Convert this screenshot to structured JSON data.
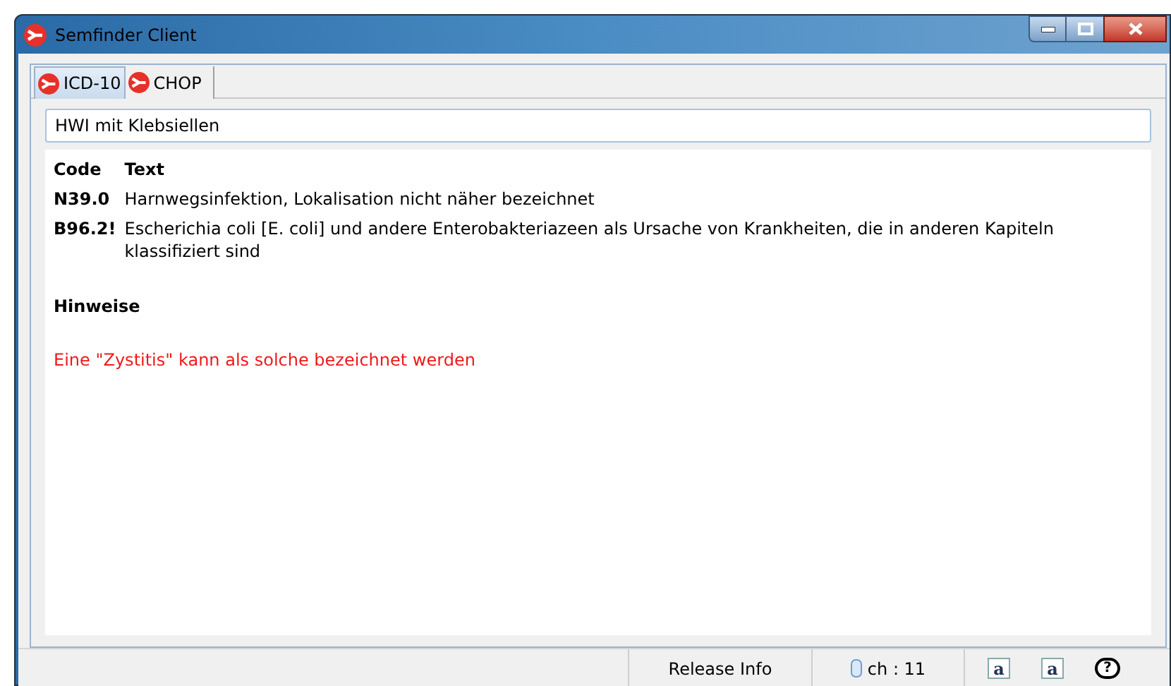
{
  "window": {
    "title": "Semfinder Client"
  },
  "tabs": [
    {
      "label": "ICD-10",
      "selected": true
    },
    {
      "label": "CHOP",
      "selected": false
    }
  ],
  "search": {
    "value": "HWI mit Klebsiellen"
  },
  "table": {
    "columns": [
      "Code",
      "Text"
    ],
    "rows": [
      {
        "code": "N39.0",
        "text": "Harnwegsinfektion, Lokalisation nicht näher bezeichnet"
      },
      {
        "code": "B96.2!",
        "text": "Escherichia coli [E. coli] und andere Enterobakteriazeen als Ursache von Krankheiten, die in anderen Kapiteln klassifiziert sind"
      }
    ]
  },
  "notes": {
    "heading": "Hinweise",
    "items": [
      "Eine \"Zystitis\" kann als solche bezeichnet werden"
    ]
  },
  "status_bar": {
    "release_info": "Release Info",
    "channel": "ch : 11",
    "font_smaller": "a",
    "font_larger": "a",
    "help": "?"
  }
}
